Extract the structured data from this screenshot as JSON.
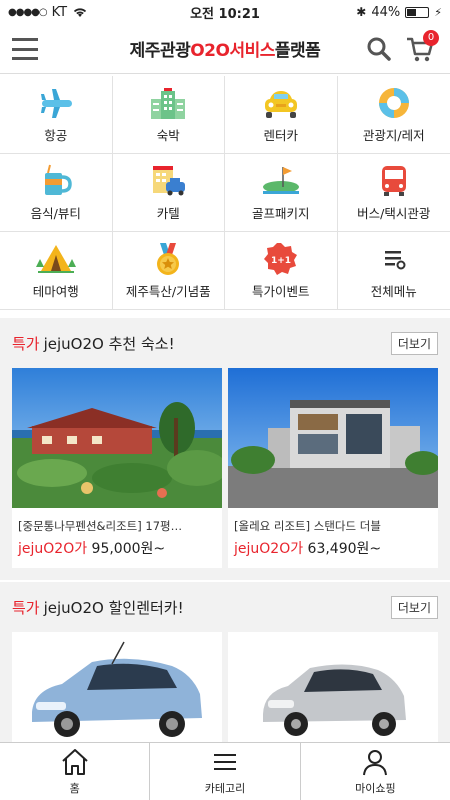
{
  "status_bar": {
    "carrier": "KT",
    "time": "오전 10:21",
    "battery": "44%",
    "battery_level": 0.44
  },
  "header": {
    "title_prefix": "제주관광",
    "title_highlight": "O2O서비스",
    "title_suffix": "플랫폼",
    "cart_count": "0"
  },
  "categories": [
    {
      "label": "항공",
      "icon": "airplane-icon"
    },
    {
      "label": "숙박",
      "icon": "hotel-icon"
    },
    {
      "label": "렌터카",
      "icon": "car-icon"
    },
    {
      "label": "관광지/레저",
      "icon": "lifebuoy-icon"
    },
    {
      "label": "음식/뷰티",
      "icon": "mug-icon"
    },
    {
      "label": "카텔",
      "icon": "cartel-icon"
    },
    {
      "label": "골프패키지",
      "icon": "golf-icon"
    },
    {
      "label": "버스/택시관광",
      "icon": "bus-icon"
    },
    {
      "label": "테마여행",
      "icon": "tent-icon"
    },
    {
      "label": "제주특산/기념품",
      "icon": "medal-icon"
    },
    {
      "label": "특가이벤트",
      "icon": "sale-badge-icon"
    },
    {
      "label": "전체메뉴",
      "icon": "list-icon"
    }
  ],
  "section_stay": {
    "hl": "특가",
    "title": "jejuO2O 추천 숙소!",
    "more": "더보기",
    "items": [
      {
        "name": "[중문통나무펜션&리조트] 17평…",
        "brand": "jejuO2O가",
        "price": "95,000원~"
      },
      {
        "name": "[올레요 리조트] 스탠다드 더블",
        "brand": "jejuO2O가",
        "price": "63,490원~"
      }
    ]
  },
  "section_car": {
    "hl": "특가",
    "title": "jejuO2O 할인렌터카!",
    "more": "더보기"
  },
  "tabbar": {
    "home": "홈",
    "category": "카테고리",
    "my": "마이쇼핑"
  },
  "colors": {
    "accent": "#e8242d"
  }
}
